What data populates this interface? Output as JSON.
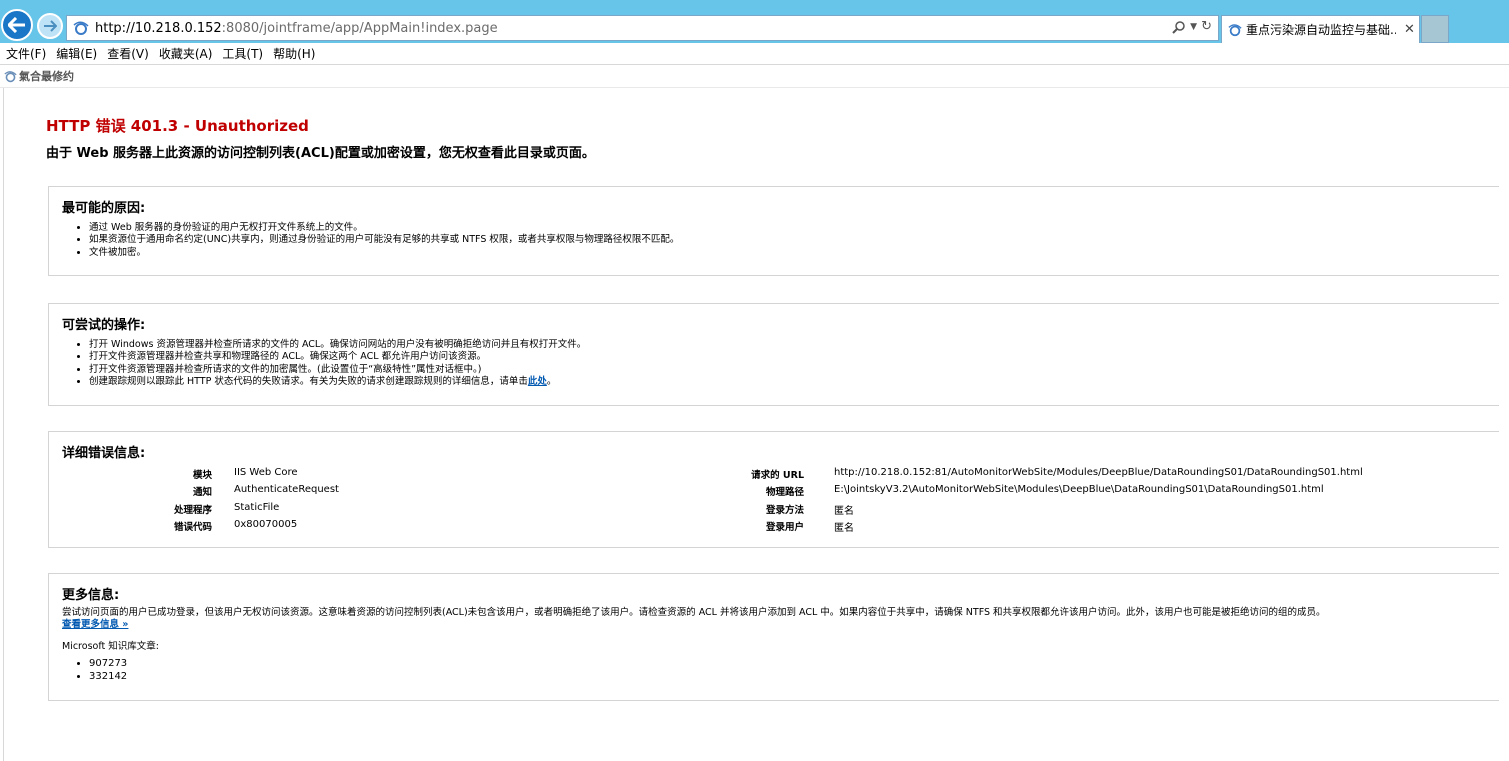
{
  "browser": {
    "url_host": "http://10.218.0.152",
    "url_rest": ":8080/jointframe/app/AppMain!index.page",
    "tab_title": "重点污染源自动监控与基础...",
    "menu": [
      "文件(F)",
      "编辑(E)",
      "查看(V)",
      "收藏夹(A)",
      "工具(T)",
      "帮助(H)"
    ],
    "favorites": [
      "氣合最修约"
    ]
  },
  "error": {
    "title": "HTTP 错误 401.3 - Unauthorized",
    "subtitle": "由于 Web 服务器上此资源的访问控制列表(ACL)配置或加密设置，您无权查看此目录或页面。"
  },
  "causes": {
    "heading": "最可能的原因:",
    "items": [
      "通过 Web 服务器的身份验证的用户无权打开文件系统上的文件。",
      "如果资源位于通用命名约定(UNC)共享内，则通过身份验证的用户可能没有足够的共享或 NTFS 权限，或者共享权限与物理路径权限不匹配。",
      "文件被加密。"
    ]
  },
  "actions": {
    "heading": "可尝试的操作:",
    "items": [
      "打开 Windows 资源管理器并检查所请求的文件的 ACL。确保访问网站的用户没有被明确拒绝访问并且有权打开文件。",
      "打开文件资源管理器并检查共享和物理路径的 ACL。确保这两个 ACL 都允许用户访问该资源。",
      "打开文件资源管理器并检查所请求的文件的加密属性。(此设置位于“高级特性”属性对话框中。)"
    ],
    "last_item_prefix": "创建跟踪规则以跟踪此 HTTP 状态代码的失败请求。有关为失败的请求创建跟踪规则的详细信息，请单击",
    "last_item_link": "此处",
    "last_item_suffix": "。"
  },
  "details": {
    "heading": "详细错误信息:",
    "left": [
      {
        "label": "模块",
        "value": "IIS Web Core"
      },
      {
        "label": "通知",
        "value": "AuthenticateRequest"
      },
      {
        "label": "处理程序",
        "value": "StaticFile"
      },
      {
        "label": "错误代码",
        "value": "0x80070005"
      }
    ],
    "right": [
      {
        "label": "请求的 URL",
        "value": "http://10.218.0.152:81/AutoMonitorWebSite/Modules/DeepBlue/DataRoundingS01/DataRoundingS01.html"
      },
      {
        "label": "物理路径",
        "value": "E:\\JointskyV3.2\\AutoMonitorWebSite\\Modules\\DeepBlue\\DataRoundingS01\\DataRoundingS01.html"
      },
      {
        "label": "登录方法",
        "value": "匿名"
      },
      {
        "label": "登录用户",
        "value": "匿名"
      }
    ]
  },
  "more": {
    "heading": "更多信息:",
    "text": "尝试访问页面的用户已成功登录，但该用户无权访问该资源。这意味着资源的访问控制列表(ACL)未包含该用户，或者明确拒绝了该用户。请检查资源的 ACL 并将该用户添加到 ACL 中。如果内容位于共享中，请确保 NTFS 和共享权限都允许该用户访问。此外，该用户也可能是被拒绝访问的组的成员。",
    "link": "查看更多信息 »",
    "kb_label": "Microsoft 知识库文章:",
    "kb_items": [
      "907273",
      "332142"
    ]
  }
}
